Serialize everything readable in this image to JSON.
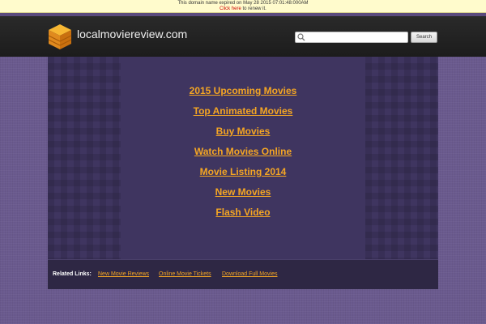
{
  "notice": {
    "line1": "This domain name expired on May 28 2015 07:01:48:000AM",
    "link": "Click here",
    "suffix": " to renew it."
  },
  "header": {
    "site_title": "localmoviereview.com",
    "search_placeholder": "",
    "search_button": "Search",
    "logo_icon": "orange-cube-icon"
  },
  "main": {
    "links": [
      {
        "label": "2015 Upcoming Movies"
      },
      {
        "label": "Top Animated Movies"
      },
      {
        "label": "Buy Movies"
      },
      {
        "label": "Watch Movies Online"
      },
      {
        "label": "Movie Listing 2014"
      },
      {
        "label": "New Movies"
      },
      {
        "label": "Flash Video"
      }
    ]
  },
  "related": {
    "label": "Related Links:",
    "links": [
      {
        "label": "New Movie Reviews"
      },
      {
        "label": "Online Movie Tickets"
      },
      {
        "label": "Download Full Movies"
      }
    ]
  },
  "colors": {
    "accent_link": "#f5a623",
    "background": "#6a5a8e",
    "header": "#1c1c1c",
    "panel": "#3f3560"
  }
}
